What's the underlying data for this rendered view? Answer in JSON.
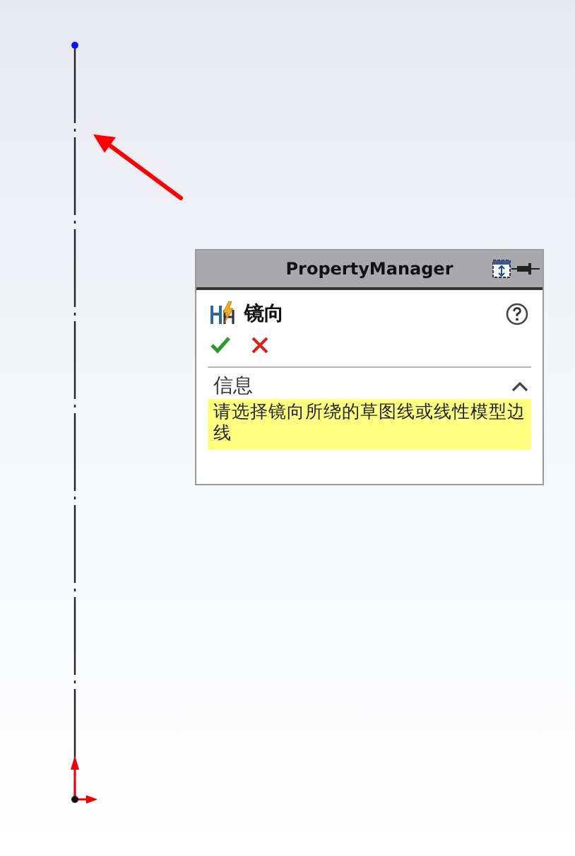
{
  "property_manager": {
    "title": "PropertyManager",
    "feature": {
      "title": "镜向"
    },
    "sections": [
      {
        "title": "信息",
        "expanded": true,
        "message": "请选择镜向所绕的草图线或线性模型边线"
      }
    ]
  }
}
